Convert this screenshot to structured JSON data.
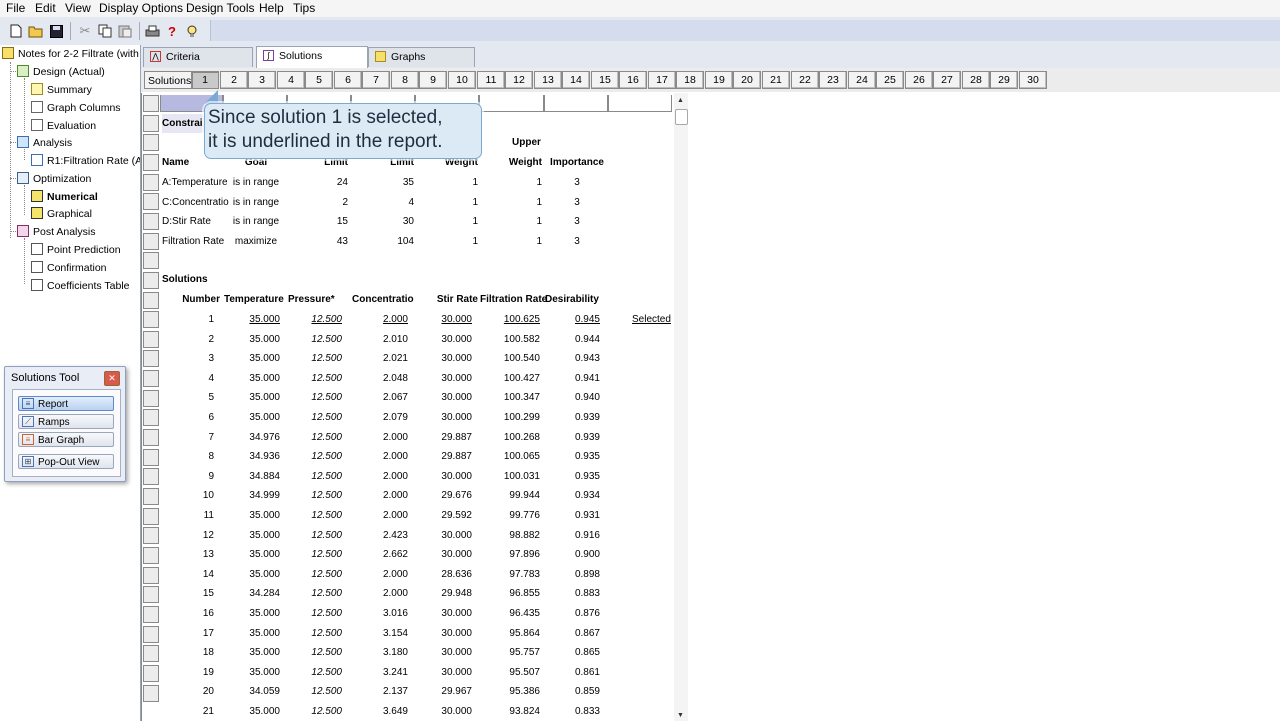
{
  "menu": [
    "File",
    "Edit",
    "View",
    "Display Options",
    "Design Tools",
    "Help",
    "Tips"
  ],
  "tree": {
    "root": "Notes for 2-2 Filtrate (with",
    "design": "Design (Actual)",
    "summary": "Summary",
    "graph_columns": "Graph Columns",
    "evaluation": "Evaluation",
    "analysis": "Analysis",
    "r1": "R1:Filtration Rate (A",
    "optimization": "Optimization",
    "numerical": "Numerical",
    "graphical": "Graphical",
    "post_analysis": "Post Analysis",
    "point_prediction": "Point Prediction",
    "confirmation": "Confirmation",
    "coefficients_table": "Coefficients Table"
  },
  "solutions_tool": {
    "title": "Solutions Tool",
    "report": "Report",
    "ramps": "Ramps",
    "bar_graph": "Bar Graph",
    "pop_out": "Pop-Out View"
  },
  "tabs": [
    "Criteria",
    "Solutions",
    "Graphs"
  ],
  "solutions_label": "Solutions",
  "solution_numbers": [
    "1",
    "2",
    "3",
    "4",
    "5",
    "6",
    "7",
    "8",
    "9",
    "10",
    "11",
    "12",
    "13",
    "14",
    "15",
    "16",
    "17",
    "18",
    "19",
    "20",
    "21",
    "22",
    "23",
    "24",
    "25",
    "26",
    "27",
    "28",
    "29",
    "30"
  ],
  "callout": {
    "line1": "Since solution 1 is selected,",
    "line2": "it is underlined in the report."
  },
  "constraints": {
    "title": "Constrai",
    "upper_header": "Upper",
    "headers": [
      "Name",
      "Goal",
      "Limit",
      "Limit",
      "Weight",
      "Weight",
      "Importance"
    ],
    "rows": [
      [
        "A:Temperature",
        "is in range",
        "24",
        "35",
        "1",
        "1",
        "3"
      ],
      [
        "C:Concentratio",
        "is in range",
        "2",
        "4",
        "1",
        "1",
        "3"
      ],
      [
        "D:Stir Rate",
        "is in range",
        "15",
        "30",
        "1",
        "1",
        "3"
      ],
      [
        "Filtration Rate",
        "maximize",
        "43",
        "104",
        "1",
        "1",
        "3"
      ]
    ]
  },
  "solutions_table": {
    "title": "Solutions",
    "headers": [
      "Number",
      "Temperature",
      "Pressure*",
      "Concentratio",
      "Stir Rate",
      "Filtration Rate",
      "Desirability"
    ],
    "selected_label": "Selected",
    "rows": [
      [
        "1",
        "35.000",
        "12.500",
        "2.000",
        "30.000",
        "100.625",
        "0.945"
      ],
      [
        "2",
        "35.000",
        "12.500",
        "2.010",
        "30.000",
        "100.582",
        "0.944"
      ],
      [
        "3",
        "35.000",
        "12.500",
        "2.021",
        "30.000",
        "100.540",
        "0.943"
      ],
      [
        "4",
        "35.000",
        "12.500",
        "2.048",
        "30.000",
        "100.427",
        "0.941"
      ],
      [
        "5",
        "35.000",
        "12.500",
        "2.067",
        "30.000",
        "100.347",
        "0.940"
      ],
      [
        "6",
        "35.000",
        "12.500",
        "2.079",
        "30.000",
        "100.299",
        "0.939"
      ],
      [
        "7",
        "34.976",
        "12.500",
        "2.000",
        "29.887",
        "100.268",
        "0.939"
      ],
      [
        "8",
        "34.936",
        "12.500",
        "2.000",
        "29.887",
        "100.065",
        "0.935"
      ],
      [
        "9",
        "34.884",
        "12.500",
        "2.000",
        "30.000",
        "100.031",
        "0.935"
      ],
      [
        "10",
        "34.999",
        "12.500",
        "2.000",
        "29.676",
        "99.944",
        "0.934"
      ],
      [
        "11",
        "35.000",
        "12.500",
        "2.000",
        "29.592",
        "99.776",
        "0.931"
      ],
      [
        "12",
        "35.000",
        "12.500",
        "2.423",
        "30.000",
        "98.882",
        "0.916"
      ],
      [
        "13",
        "35.000",
        "12.500",
        "2.662",
        "30.000",
        "97.896",
        "0.900"
      ],
      [
        "14",
        "35.000",
        "12.500",
        "2.000",
        "28.636",
        "97.783",
        "0.898"
      ],
      [
        "15",
        "34.284",
        "12.500",
        "2.000",
        "29.948",
        "96.855",
        "0.883"
      ],
      [
        "16",
        "35.000",
        "12.500",
        "3.016",
        "30.000",
        "96.435",
        "0.876"
      ],
      [
        "17",
        "35.000",
        "12.500",
        "3.154",
        "30.000",
        "95.864",
        "0.867"
      ],
      [
        "18",
        "35.000",
        "12.500",
        "3.180",
        "30.000",
        "95.757",
        "0.865"
      ],
      [
        "19",
        "35.000",
        "12.500",
        "3.241",
        "30.000",
        "95.507",
        "0.861"
      ],
      [
        "20",
        "34.059",
        "12.500",
        "2.137",
        "29.967",
        "95.386",
        "0.859"
      ],
      [
        "21",
        "35.000",
        "12.500",
        "3.649",
        "30.000",
        "93.824",
        "0.833"
      ]
    ]
  }
}
